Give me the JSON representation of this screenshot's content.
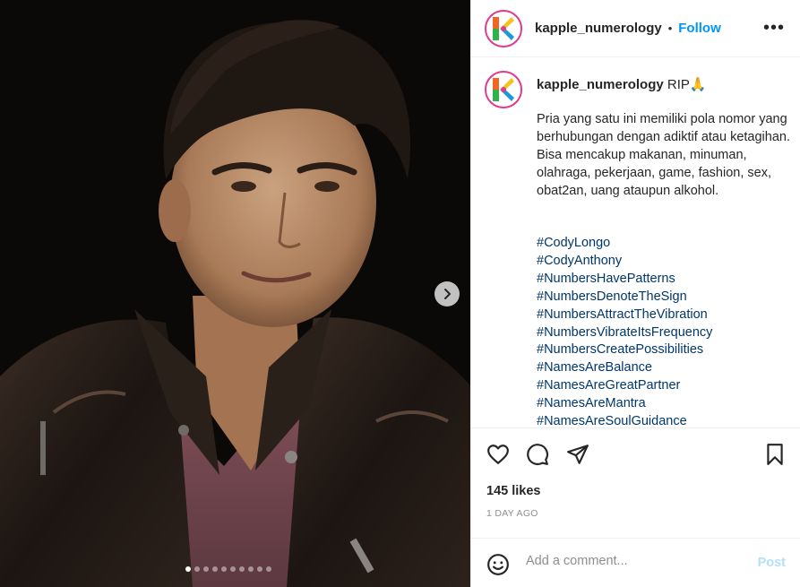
{
  "post": {
    "username": "kapple_numerology",
    "separator": "•",
    "follow_label": "Follow",
    "more_icon": "more-horizontal-icon"
  },
  "caption": {
    "username": "kapple_numerology",
    "headline": "RIP🙏",
    "body": "Pria yang satu ini memiliki pola nomor yang berhubungan dengan adiktif atau ketagihan.\nBisa mencakup makanan, minuman, olahraga, pekerjaan, game, fashion, sex, obat2an, uang ataupun alkohol.",
    "hashtags": [
      "#CodyLongo",
      "#CodyAnthony",
      "#NumbersHavePatterns",
      "#NumbersDenoteTheSign",
      "#NumbersAttractTheVibration",
      "#NumbersVibrateItsFrequency",
      "#NumbersCreatePossibilities",
      "#NamesAreBalance",
      "#NamesAreGreatPartner",
      "#NamesAreMantra",
      "#NamesAreSoulGuidance"
    ]
  },
  "stats": {
    "likes": "145 likes",
    "time": "1 DAY AGO"
  },
  "comment": {
    "placeholder": "Add a comment...",
    "post_label": "Post"
  },
  "carousel": {
    "total_slides": 10,
    "current_slide": 1
  },
  "colors": {
    "follow": "#0095f6",
    "hashtag": "#00376b",
    "post_disabled": "#b2dffc",
    "muted": "#8e8e8e"
  }
}
